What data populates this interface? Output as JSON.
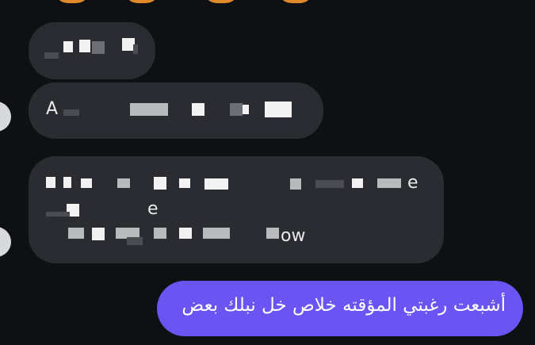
{
  "messages": {
    "incoming": [
      {
        "visible_text": ""
      },
      {
        "visible_text": "A"
      },
      {
        "visible_text_line2": "e",
        "visible_text_line3": "e",
        "visible_text_line4": "ow"
      }
    ],
    "outgoing": [
      {
        "text": "أشبعت رغبتي المؤقته خلاص خل نبلك بعض"
      }
    ]
  },
  "colors": {
    "background": "#0e1014",
    "incoming_bubble": "#2a2c31",
    "outgoing_bubble": "#6a55f2",
    "reaction": "#e08a2c",
    "avatar": "#d8d9dc"
  }
}
